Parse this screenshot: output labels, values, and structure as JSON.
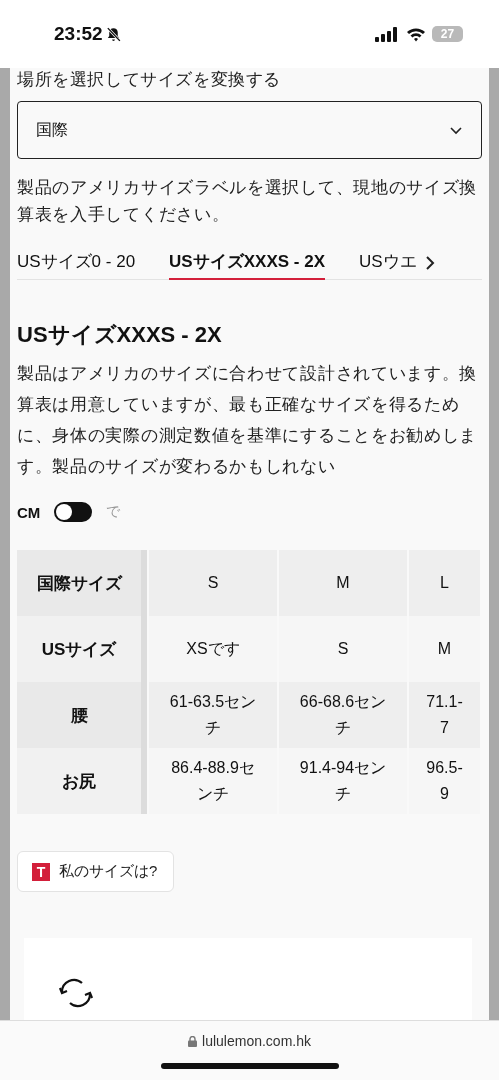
{
  "status_bar": {
    "time": "23:52",
    "muted": true,
    "battery": "27"
  },
  "location": {
    "label": "場所を選択してサイズを変換する",
    "value": "国際"
  },
  "description": "製品のアメリカサイズラベルを選択して、現地のサイズ換算表を入手してください。",
  "tabs": [
    {
      "label": "USサイズ0 - 20",
      "selected": false
    },
    {
      "label": "USサイズXXXS - 2X",
      "selected": true
    },
    {
      "label": "USウエ",
      "selected": false
    }
  ],
  "section": {
    "title": "USサイズXXXS - 2X",
    "body": "製品はアメリカのサイズに合わせて設計されています。換算表は用意していますが、最も正確なサイズを得るために、身体の実際の測定数値を基準にすることをお勧めします。製品のサイズが変わるかもしれない"
  },
  "unit_toggle": {
    "label": "CM",
    "on": false,
    "off_label": "で"
  },
  "table": {
    "rows": [
      {
        "header": "国際サイズ",
        "cells": [
          "S",
          "M",
          "L"
        ]
      },
      {
        "header": "USサイズ",
        "cells": [
          "XSです",
          "S",
          "M"
        ]
      },
      {
        "header": "腰",
        "cells": [
          "61-63.5センチ",
          "66-68.6センチ",
          "71.1-7"
        ]
      },
      {
        "header": "お尻",
        "cells": [
          "86.4-88.9センチ",
          "91.4-94センチ",
          "96.5-9"
        ]
      }
    ]
  },
  "size_button": {
    "logo": "T",
    "label": "私のサイズは?"
  },
  "address_bar": {
    "url": "lululemon.com.hk"
  }
}
